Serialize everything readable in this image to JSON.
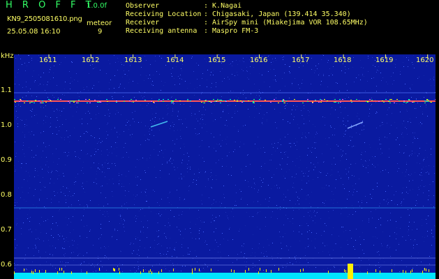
{
  "header": {
    "app_title": "H R O F F T",
    "version": "1.0.0f",
    "filename": "KN9_2505081610.png",
    "meteor_label": "meteor",
    "datetime": "25.05.08 16:10",
    "meteor_count": "9"
  },
  "meta": [
    {
      "key": "Observer",
      "value": ": K.Nagai"
    },
    {
      "key": "Receiving Location",
      "value": ": Chigasaki, Japan (139.414 35.340)"
    },
    {
      "key": "Receiver",
      "value": ": AirSpy mini (Miakejima VOR 108.65MHz)"
    },
    {
      "key": "Receiving antenna",
      "value": ": Maspro FM-3"
    }
  ],
  "axis": {
    "y_unit": "kHz",
    "y_ticks": [
      "1.1",
      "1.0",
      "0.9",
      "0.8",
      "0.7",
      "0.6"
    ],
    "x_ticks": [
      "1611",
      "1612",
      "1613",
      "1614",
      "1615",
      "1616",
      "1617",
      "1618",
      "1619",
      "1620"
    ]
  },
  "colors": {
    "background": "#0a1aa0",
    "text": "#ffff66",
    "title": "#33ff66",
    "carrier": "#ff4444",
    "baseline": "#00e5ff"
  }
}
